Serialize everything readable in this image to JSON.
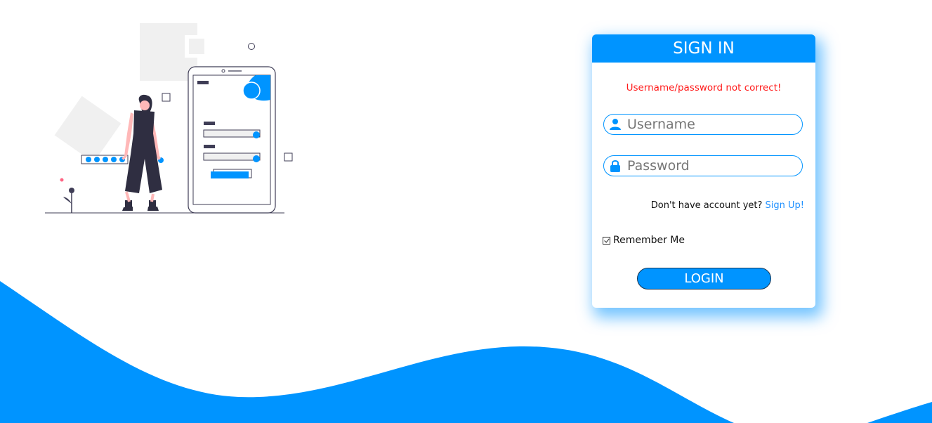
{
  "colors": {
    "accent": "#0094ff",
    "error": "#ff1a1a",
    "link": "#1e90ff"
  },
  "login_card": {
    "title": "SIGN IN",
    "error_message": "Username/password not correct!",
    "username": {
      "placeholder": "Username",
      "value": "",
      "icon": "user-icon"
    },
    "password": {
      "placeholder": "Password",
      "value": "",
      "icon": "lock-icon"
    },
    "signup_prompt": "Don't have account yet?",
    "signup_link": "Sign Up!",
    "remember_me_label": "Remember Me",
    "remember_me_checked": true,
    "login_button": "LOGIN"
  },
  "illustration": {
    "icon": "person-phone-login-illustration"
  }
}
